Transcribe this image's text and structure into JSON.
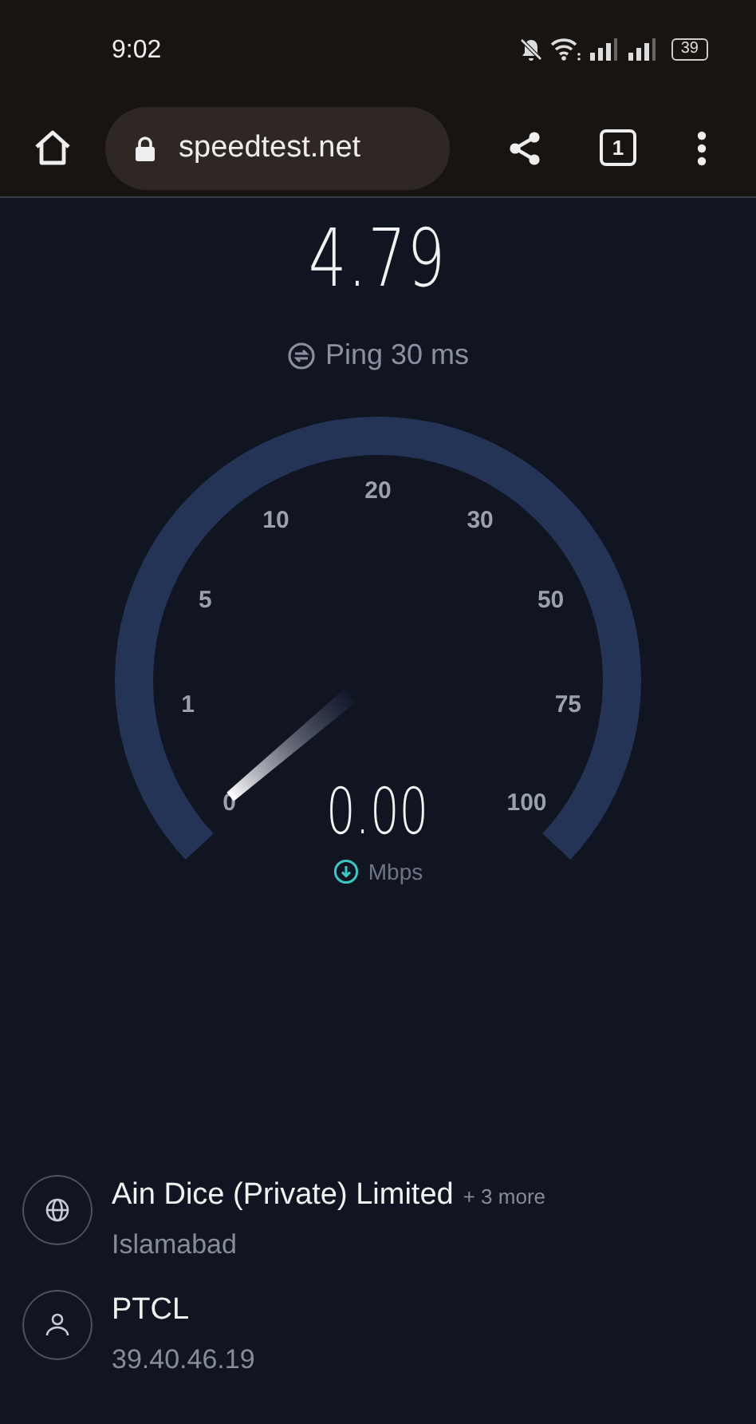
{
  "status_bar": {
    "time": "9:02",
    "battery": "39"
  },
  "browser": {
    "url": "speedtest.net",
    "tab_count": "1"
  },
  "result": {
    "value": "4.79",
    "ping": "Ping 30 ms"
  },
  "gauge": {
    "scale": [
      "0",
      "1",
      "5",
      "10",
      "20",
      "30",
      "50",
      "75",
      "100"
    ],
    "reading": "0.00",
    "unit": "Mbps"
  },
  "connections": [
    {
      "kind": "server",
      "title": "Ain Dice (Private) Limited",
      "extra": "+ 3 more",
      "subtitle": "Islamabad"
    },
    {
      "kind": "provider",
      "title": "PTCL",
      "subtitle": "39.40.46.19"
    }
  ]
}
